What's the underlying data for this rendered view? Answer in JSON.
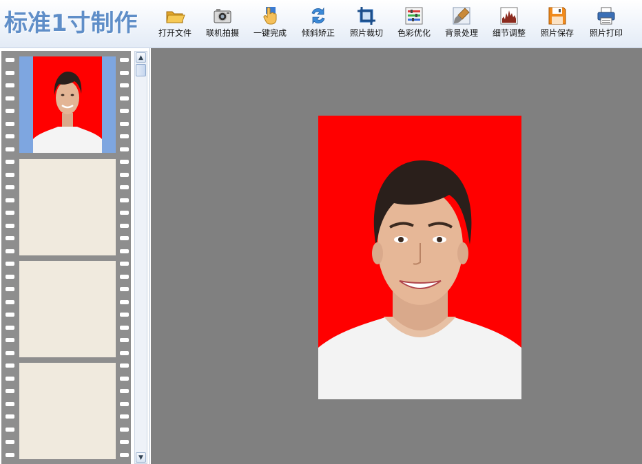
{
  "app": {
    "title": "标准1寸制作"
  },
  "toolbar": {
    "items": [
      {
        "label": "打开文件",
        "icon": "folder-open-icon"
      },
      {
        "label": "联机拍摄",
        "icon": "camera-icon"
      },
      {
        "label": "一键完成",
        "icon": "hand-pointer-icon"
      },
      {
        "label": "倾斜矫正",
        "icon": "rotate-arrows-icon"
      },
      {
        "label": "照片裁切",
        "icon": "crop-icon"
      },
      {
        "label": "色彩优化",
        "icon": "color-sliders-icon"
      },
      {
        "label": "背景处理",
        "icon": "paint-brush-icon"
      },
      {
        "label": "细节调整",
        "icon": "histogram-icon"
      },
      {
        "label": "照片保存",
        "icon": "floppy-disk-icon"
      },
      {
        "label": "照片打印",
        "icon": "printer-icon"
      }
    ]
  },
  "filmstrip": {
    "slots": [
      {
        "state": "selected",
        "has_photo": true
      },
      {
        "state": "empty",
        "has_photo": false
      },
      {
        "state": "empty",
        "has_photo": false
      },
      {
        "state": "empty",
        "has_photo": false
      }
    ],
    "scrollbar": {
      "up_icon": "arrow-up-icon",
      "down_icon": "arrow-down-icon"
    }
  },
  "canvas": {
    "background_color": "#808080",
    "photo_background_color": "#ff0000"
  },
  "colors": {
    "title": "#5f8ec8",
    "selected_slot": "#7ea6e0",
    "empty_slot": "#f0eade",
    "film": "#8e8e8e"
  }
}
